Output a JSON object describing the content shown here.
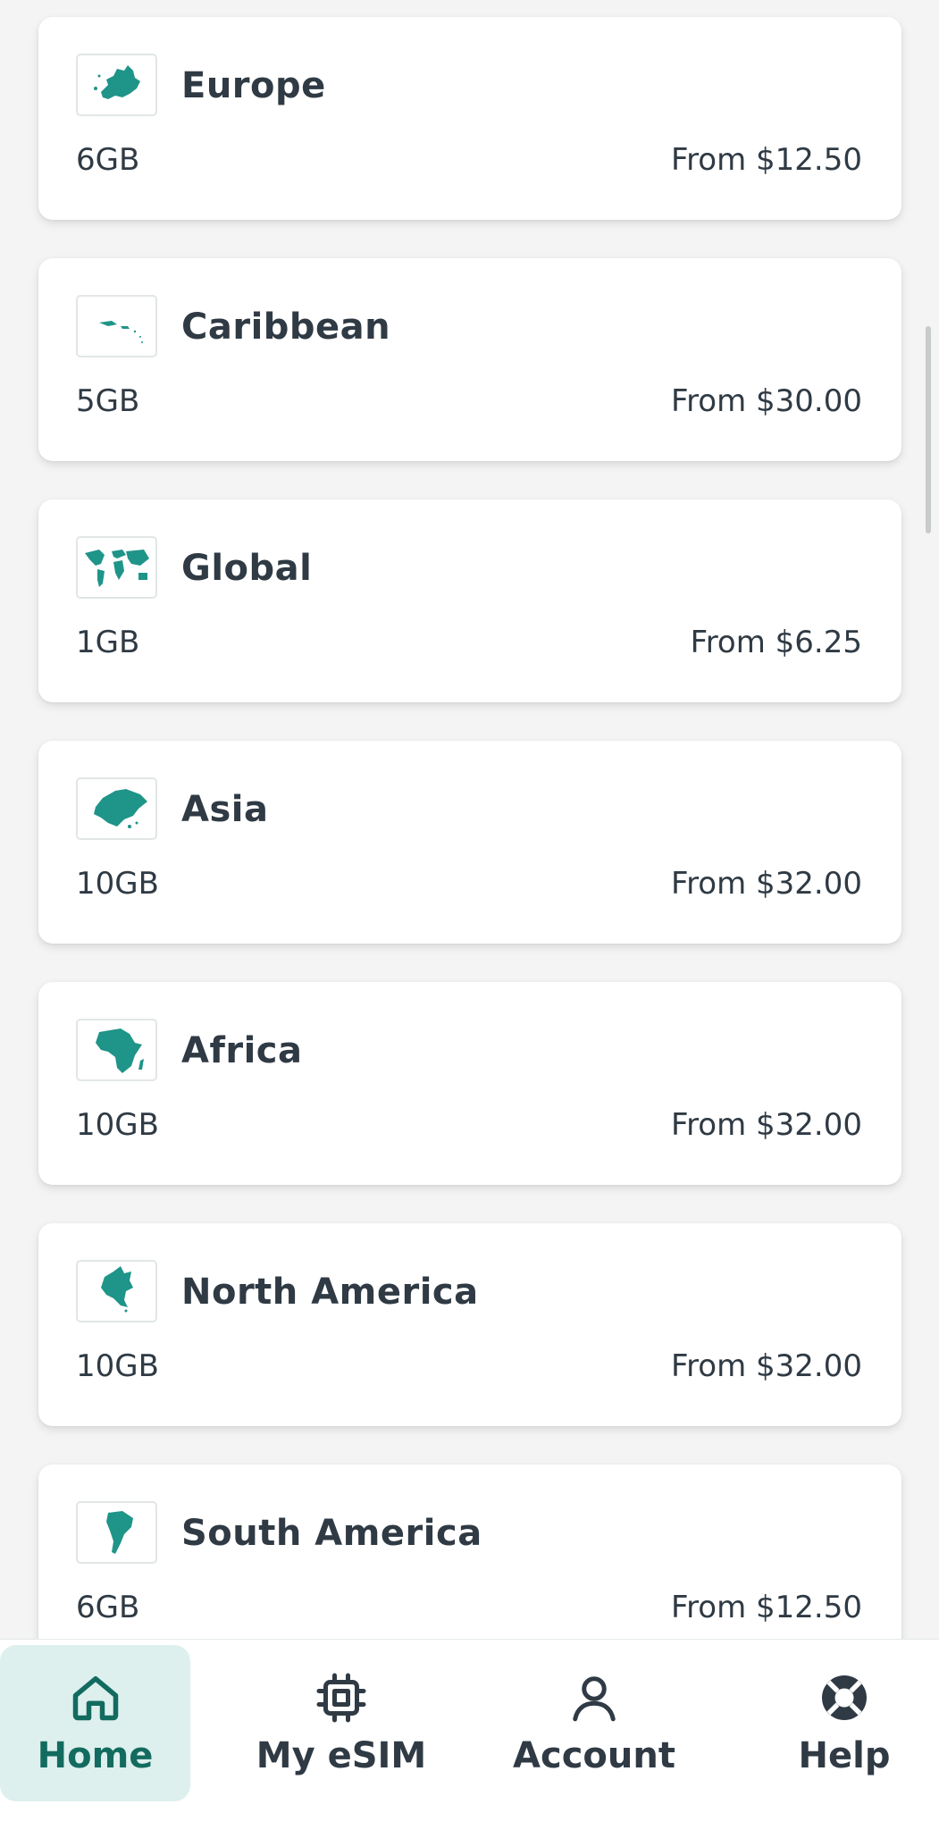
{
  "regions": [
    {
      "name": "Europe",
      "data": "6GB",
      "price": "From $12.50",
      "icon": "europe-map-icon"
    },
    {
      "name": "Caribbean",
      "data": "5GB",
      "price": "From $30.00",
      "icon": "caribbean-map-icon"
    },
    {
      "name": "Global",
      "data": "1GB",
      "price": "From $6.25",
      "icon": "world-map-icon"
    },
    {
      "name": "Asia",
      "data": "10GB",
      "price": "From $32.00",
      "icon": "asia-map-icon"
    },
    {
      "name": "Africa",
      "data": "10GB",
      "price": "From $32.00",
      "icon": "africa-map-icon"
    },
    {
      "name": "North America",
      "data": "10GB",
      "price": "From $32.00",
      "icon": "north-america-map-icon"
    },
    {
      "name": "South America",
      "data": "6GB",
      "price": "From $12.50",
      "icon": "south-america-map-icon"
    }
  ],
  "nav": {
    "home": "Home",
    "myesim": "My eSIM",
    "account": "Account",
    "help": "Help"
  },
  "colors": {
    "map": "#1f9488",
    "nav_active": "#136b5f",
    "nav_active_bg": "#ddf0ee",
    "text": "#2f3a44"
  }
}
